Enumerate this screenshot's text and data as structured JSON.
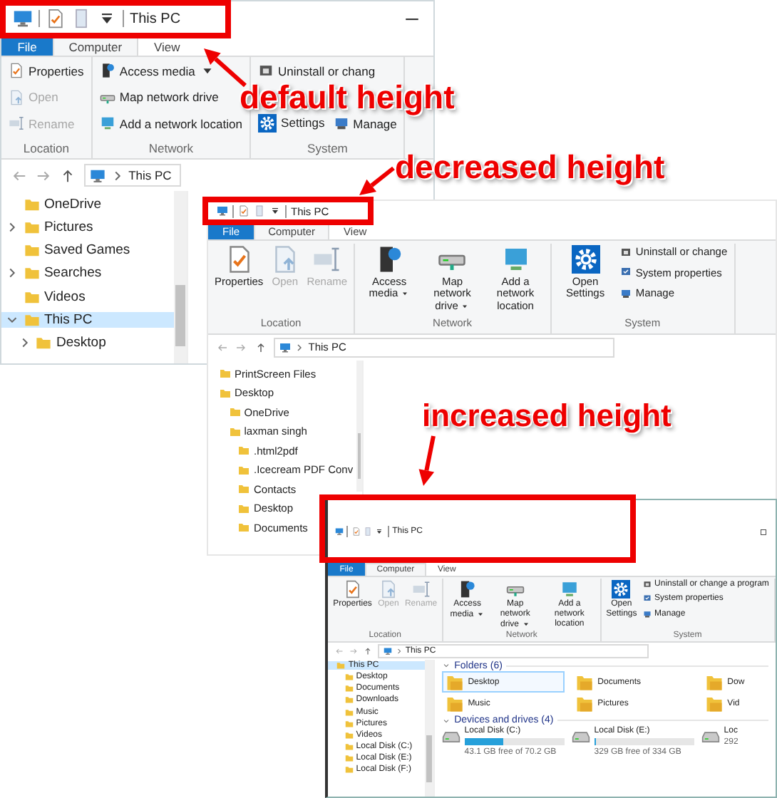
{
  "windows": [
    {
      "kind": "default",
      "title": "This PC",
      "caption_buttons": [
        {
          "kind": "minimize"
        }
      ],
      "tabs": [
        {
          "label": "File",
          "kind": "file",
          "selected": false
        },
        {
          "label": "Computer",
          "kind": "tab",
          "selected": true
        },
        {
          "label": "View",
          "kind": "tab",
          "selected": false
        }
      ],
      "ribbon": [
        {
          "label": "Location",
          "items": [
            {
              "label": "Properties",
              "kind": "properties",
              "disabled": false,
              "dropdown": false
            },
            {
              "label": "Open",
              "kind": "open",
              "disabled": true,
              "dropdown": false
            },
            {
              "label": "Rename",
              "kind": "rename",
              "disabled": true,
              "dropdown": false
            }
          ]
        },
        {
          "label": "Network",
          "items": [
            {
              "label": "Access media",
              "kind": "media",
              "disabled": false,
              "dropdown": true
            },
            {
              "label": "Map network drive",
              "kind": "map",
              "disabled": false,
              "dropdown": false
            },
            {
              "label": "Add a network location",
              "kind": "netloc",
              "disabled": false,
              "dropdown": false
            }
          ]
        },
        {
          "label": "System",
          "items": [
            {
              "label": "Settings",
              "kind": "settings",
              "disabled": false,
              "dropdown": false
            },
            {
              "label": "Uninstall or chang",
              "kind": "uninstall",
              "disabled": false,
              "dropdown": false
            },
            {
              "label": "Manage",
              "kind": "manage",
              "disabled": false,
              "dropdown": false
            }
          ]
        }
      ],
      "address": "This PC",
      "tree": [
        {
          "label": "OneDrive",
          "kind": "leaf",
          "selected": false
        },
        {
          "label": "Pictures",
          "kind": "branch",
          "expanded": false,
          "selected": false
        },
        {
          "label": "Saved Games",
          "kind": "leaf",
          "selected": false
        },
        {
          "label": "Searches",
          "kind": "branch",
          "expanded": false,
          "selected": false
        },
        {
          "label": "Videos",
          "kind": "leaf",
          "selected": false
        },
        {
          "label": "This PC",
          "kind": "branch",
          "expanded": true,
          "selected": true,
          "children": [
            {
              "label": "Desktop",
              "kind": "branch",
              "expanded": false,
              "selected": false
            }
          ]
        }
      ]
    },
    {
      "kind": "decreased",
      "title": "This PC",
      "tabs": [
        {
          "label": "File",
          "kind": "file",
          "selected": false
        },
        {
          "label": "Computer",
          "kind": "tab",
          "selected": true
        },
        {
          "label": "View",
          "kind": "tab",
          "selected": false
        }
      ],
      "ribbon": [
        {
          "label": "Location",
          "items": [
            {
              "label": "Properties",
              "kind": "properties",
              "disabled": false,
              "dropdown": false
            },
            {
              "label": "Open",
              "kind": "open",
              "disabled": true,
              "dropdown": false
            },
            {
              "label": "Rename",
              "kind": "rename",
              "disabled": true,
              "dropdown": false
            }
          ]
        },
        {
          "label": "Network",
          "items": [
            {
              "label": "Access media",
              "kind": "media",
              "disabled": false,
              "dropdown": true
            },
            {
              "label": "Map network drive",
              "kind": "map",
              "disabled": false,
              "dropdown": true
            },
            {
              "label": "Add a network location",
              "kind": "netloc",
              "disabled": false,
              "dropdown": false
            }
          ]
        },
        {
          "label": "System",
          "items": [
            {
              "label": "Open Settings",
              "kind": "settings",
              "disabled": false,
              "dropdown": false
            },
            {
              "label": "Uninstall or change",
              "kind": "uninstall",
              "disabled": false,
              "dropdown": false
            },
            {
              "label": "System properties",
              "kind": "sysprops",
              "disabled": false,
              "dropdown": false
            },
            {
              "label": "Manage",
              "kind": "manage",
              "disabled": false,
              "dropdown": false
            }
          ]
        }
      ],
      "address": "This PC",
      "tree": [
        {
          "label": "PrintScreen Files",
          "selected": false
        },
        {
          "label": "Desktop",
          "selected": false,
          "children": [
            {
              "label": "OneDrive",
              "selected": false
            },
            {
              "label": "laxman singh",
              "selected": false,
              "children": [
                {
                  "label": ".html2pdf",
                  "selected": false
                },
                {
                  "label": ".Icecream PDF Conv",
                  "selected": false
                },
                {
                  "label": "Contacts",
                  "selected": false
                },
                {
                  "label": "Desktop",
                  "selected": false
                },
                {
                  "label": "Documents",
                  "selected": false
                }
              ]
            }
          ]
        }
      ]
    },
    {
      "kind": "increased",
      "title": "This PC",
      "caption_buttons": [
        {
          "kind": "maximize"
        }
      ],
      "tabs": [
        {
          "label": "File",
          "kind": "file",
          "selected": false
        },
        {
          "label": "Computer",
          "kind": "tab",
          "selected": true
        },
        {
          "label": "View",
          "kind": "tab",
          "selected": false
        }
      ],
      "ribbon": [
        {
          "label": "Location",
          "items": [
            {
              "label": "Properties",
              "kind": "properties",
              "disabled": false,
              "dropdown": false
            },
            {
              "label": "Open",
              "kind": "open",
              "disabled": true,
              "dropdown": false
            },
            {
              "label": "Rename",
              "kind": "rename",
              "disabled": true,
              "dropdown": false
            }
          ]
        },
        {
          "label": "Network",
          "items": [
            {
              "label": "Access media",
              "kind": "media",
              "disabled": false,
              "dropdown": true
            },
            {
              "label": "Map network drive",
              "kind": "map",
              "disabled": false,
              "dropdown": true
            },
            {
              "label": "Add a network location",
              "kind": "netloc",
              "disabled": false,
              "dropdown": false
            }
          ]
        },
        {
          "label": "System",
          "items": [
            {
              "label": "Open Settings",
              "kind": "settings",
              "disabled": false,
              "dropdown": false
            },
            {
              "label": "Uninstall or change a program",
              "kind": "uninstall",
              "disabled": false,
              "dropdown": false
            },
            {
              "label": "System properties",
              "kind": "sysprops",
              "disabled": false,
              "dropdown": false
            },
            {
              "label": "Manage",
              "kind": "manage",
              "disabled": false,
              "dropdown": false
            }
          ]
        }
      ],
      "address": "This PC",
      "tree": [
        {
          "label": "This PC",
          "selected": true,
          "children": [
            {
              "label": "Desktop",
              "selected": false
            },
            {
              "label": "Documents",
              "selected": false
            },
            {
              "label": "Downloads",
              "selected": false
            },
            {
              "label": "Music",
              "selected": false
            },
            {
              "label": "Pictures",
              "selected": false
            },
            {
              "label": "Videos",
              "selected": false
            },
            {
              "label": "Local Disk (C:)",
              "selected": false
            },
            {
              "label": "Local Disk (E:)",
              "selected": false
            },
            {
              "label": "Local Disk (F:)",
              "selected": false
            }
          ]
        }
      ],
      "content": [
        {
          "title": "Folders (6)",
          "kind": "folders",
          "items": [
            {
              "label": "Desktop",
              "selected": true
            },
            {
              "label": "Documents",
              "selected": false
            },
            {
              "label": "Dow",
              "selected": false
            },
            {
              "label": "Music",
              "selected": false
            },
            {
              "label": "Pictures",
              "selected": false
            },
            {
              "label": "Vid",
              "selected": false
            }
          ]
        },
        {
          "title": "Devices and drives (4)",
          "kind": "drives",
          "items": [
            {
              "label": "Local Disk (C:)",
              "free": "43.1 GB free of 70.2 GB",
              "level": 0.39
            },
            {
              "label": "Local Disk (E:)",
              "free": "329 GB free of 334 GB",
              "level": 0.02
            },
            {
              "label": "Loc",
              "free": "292"
            }
          ]
        }
      ]
    }
  ],
  "annotations": [
    {
      "text": "default height"
    },
    {
      "text": "decreased height"
    },
    {
      "text": "increased height"
    }
  ]
}
